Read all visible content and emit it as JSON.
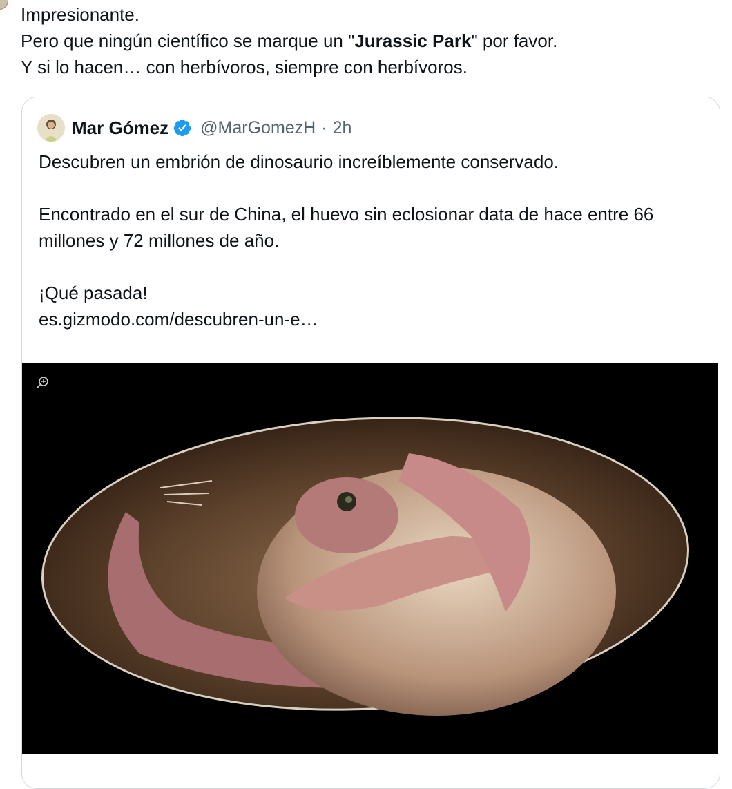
{
  "tweet": {
    "line1": "Impresionante.",
    "line2_before": "Pero que ningún científico se marque un \"",
    "line2_bold": "Jurassic Park",
    "line2_after": "\" por favor.",
    "line3": "Y si lo hacen… con herbívoros, siempre con herbívoros."
  },
  "quote": {
    "author_name": "Mar Gómez",
    "handle": "@MarGomezH",
    "separator": "·",
    "time": "2h",
    "text": "Descubren un embrión de dinosaurio increíblemente conservado.\n\nEncontrado en el sur de China, el huevo sin eclosionar data de hace entre 66 millones y 72 millones de año.\n\n¡Qué pasada!\nes.gizmodo.com/descubren-un-e…"
  },
  "icons": {
    "verified": "verified-badge-icon",
    "zoom": "zoom-in-icon"
  },
  "colors": {
    "text": "#0f1419",
    "secondary": "#536471",
    "verified": "#1d9bf0",
    "border": "#cfd9de"
  }
}
